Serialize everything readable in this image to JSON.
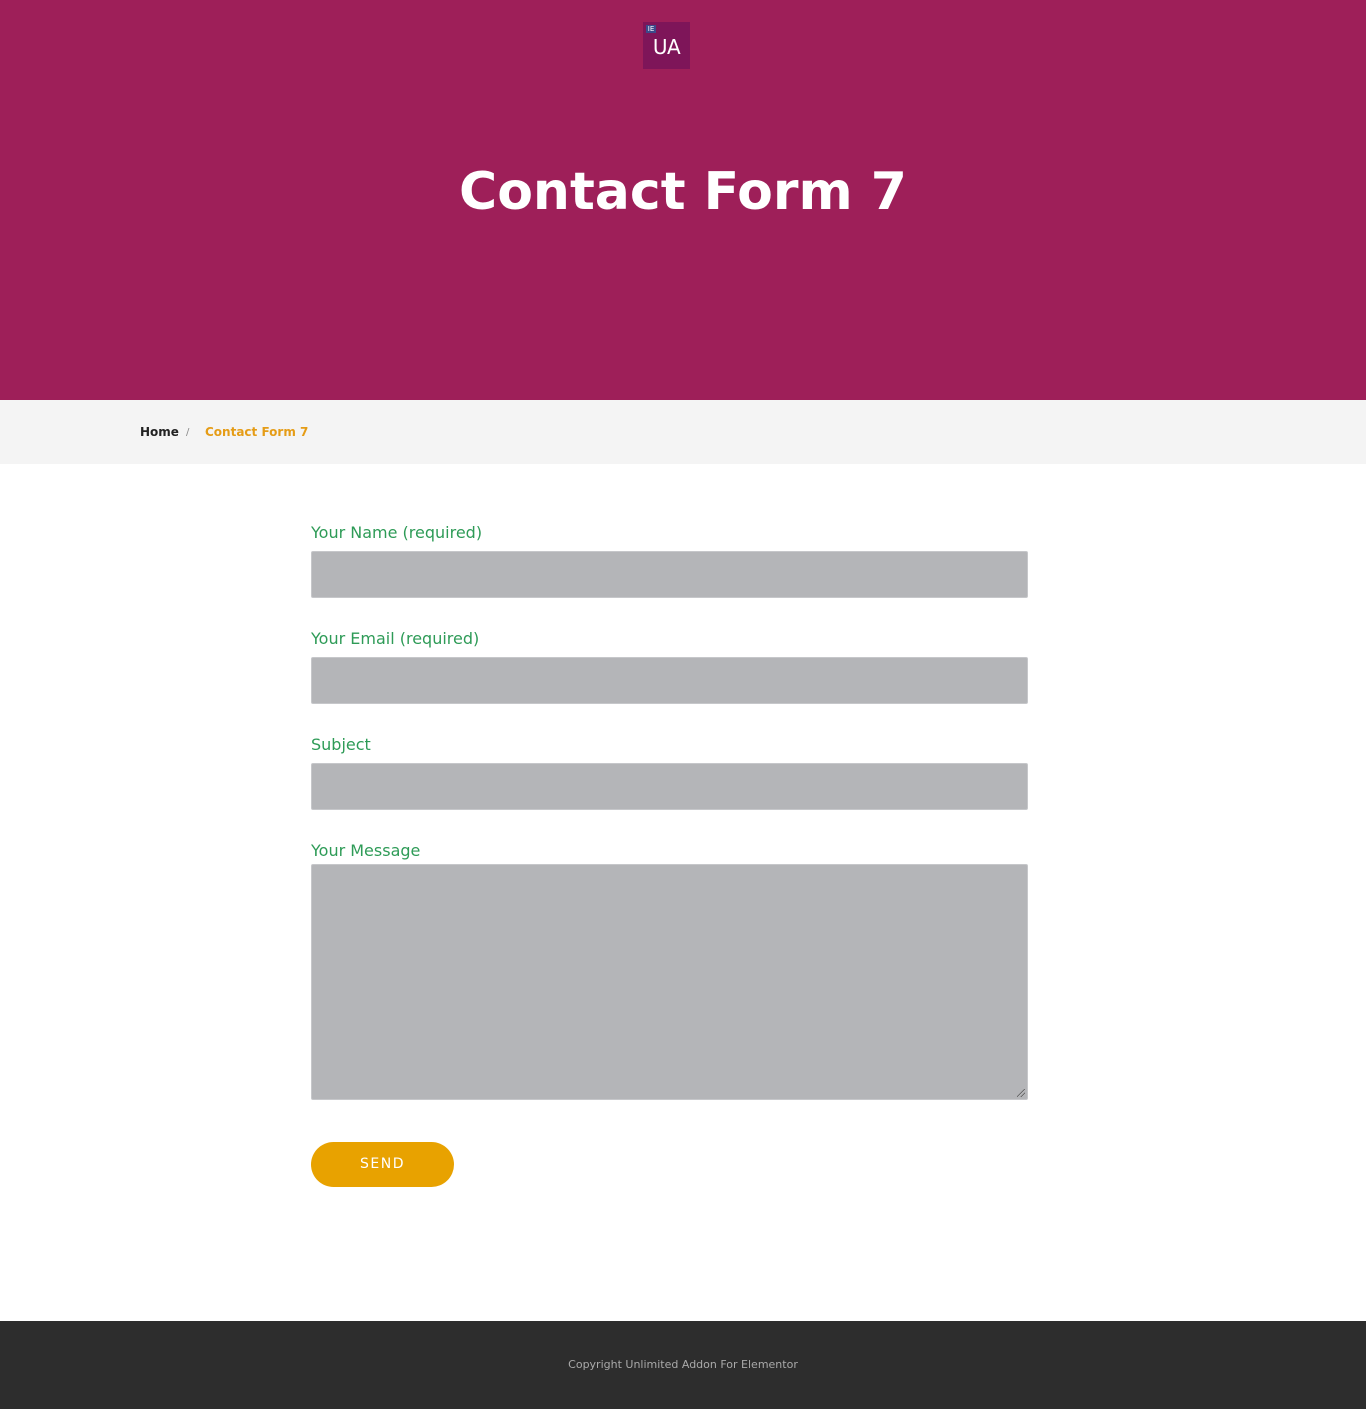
{
  "colors": {
    "hero_bg": "#9e1f59",
    "logo_bg": "#7e1559",
    "label": "#2e9b57",
    "input_bg": "#b4b5b8",
    "breadcrumb_active": "#e59c16",
    "button_bg": "#e8a200",
    "footer_bg": "#2d2d2d"
  },
  "logo": {
    "badge": "IE",
    "text": "UA",
    "icon": "logo-icon"
  },
  "hero": {
    "title": "Contact Form 7"
  },
  "breadcrumb": {
    "home": "Home",
    "separator": "/",
    "current": "Contact Form 7"
  },
  "form": {
    "name_label": "Your Name (required)",
    "name_value": "",
    "email_label": "Your Email (required)",
    "email_value": "",
    "subject_label": "Subject",
    "subject_value": "",
    "message_label": "Your Message",
    "message_value": "",
    "send_label": "SEND"
  },
  "footer": {
    "copyright": "Copyright Unlimited Addon For Elementor"
  }
}
